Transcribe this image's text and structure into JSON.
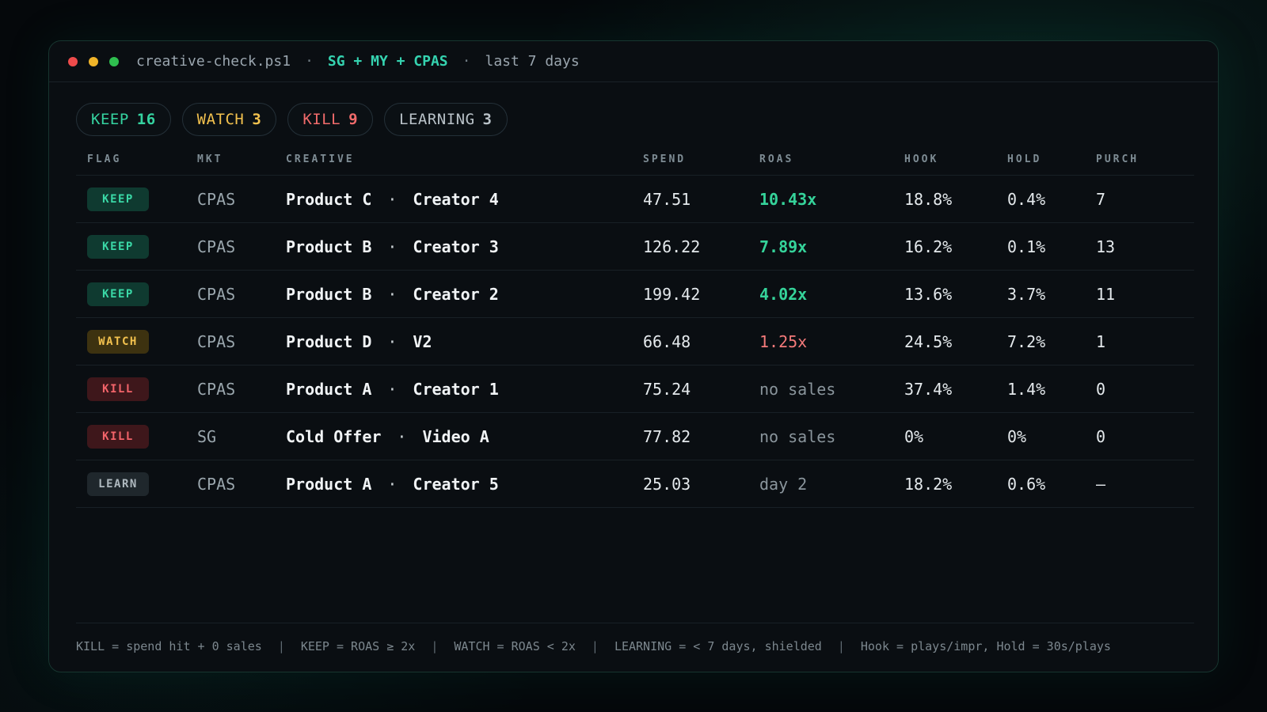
{
  "titlebar": {
    "script": "creative-check.ps1",
    "sep": "·",
    "scope": "SG + MY + CPAS",
    "range": "last 7 days"
  },
  "summary": [
    {
      "label": "KEEP",
      "count": "16"
    },
    {
      "label": "WATCH",
      "count": "3"
    },
    {
      "label": "KILL",
      "count": "9"
    },
    {
      "label": "LEARNING",
      "count": "3"
    }
  ],
  "columns": {
    "flag": "FLAG",
    "mkt": "MKT",
    "creative": "CREATIVE",
    "spend": "SPEND",
    "roas": "ROAS",
    "hook": "HOOK",
    "hold": "HOLD",
    "purch": "PURCH"
  },
  "rows": [
    {
      "flag": "KEEP",
      "mkt": "CPAS",
      "product": "Product C",
      "sep": "·",
      "variant": "Creator 4",
      "spend": "47.51",
      "roas": "10.43x",
      "hook": "18.8%",
      "hold": "0.4%",
      "purch": "7"
    },
    {
      "flag": "KEEP",
      "mkt": "CPAS",
      "product": "Product B",
      "sep": "·",
      "variant": "Creator 3",
      "spend": "126.22",
      "roas": "7.89x",
      "hook": "16.2%",
      "hold": "0.1%",
      "purch": "13"
    },
    {
      "flag": "KEEP",
      "mkt": "CPAS",
      "product": "Product B",
      "sep": "·",
      "variant": "Creator 2",
      "spend": "199.42",
      "roas": "4.02x",
      "hook": "13.6%",
      "hold": "3.7%",
      "purch": "11"
    },
    {
      "flag": "WATCH",
      "mkt": "CPAS",
      "product": "Product D",
      "sep": "·",
      "variant": "V2",
      "spend": "66.48",
      "roas": "1.25x",
      "hook": "24.5%",
      "hold": "7.2%",
      "purch": "1"
    },
    {
      "flag": "KILL",
      "mkt": "CPAS",
      "product": "Product A",
      "sep": "·",
      "variant": "Creator 1",
      "spend": "75.24",
      "roas": "no sales",
      "hook": "37.4%",
      "hold": "1.4%",
      "purch": "0"
    },
    {
      "flag": "KILL",
      "mkt": "SG",
      "product": "Cold Offer",
      "sep": "·",
      "variant": "Video A",
      "spend": "77.82",
      "roas": "no sales",
      "hook": "0%",
      "hold": "0%",
      "purch": "0"
    },
    {
      "flag": "LEARN",
      "mkt": "CPAS",
      "product": "Product A",
      "sep": "·",
      "variant": "Creator 5",
      "spend": "25.03",
      "roas": "day 2",
      "hook": "18.2%",
      "hold": "0.6%",
      "purch": "–"
    }
  ],
  "footer": {
    "sep": "|",
    "items": [
      "KILL = spend hit + 0 sales",
      "KEEP = ROAS ≥ 2x",
      "WATCH = ROAS < 2x",
      "LEARNING = < 7 days, shielded",
      "Hook = plays/impr, Hold = 30s/plays"
    ]
  },
  "colors": {
    "keep": "#35d3a0",
    "watch": "#f2c14e",
    "kill": "#f16b6b",
    "learn": "#b9c2c8",
    "accent": "#35d3b0"
  }
}
